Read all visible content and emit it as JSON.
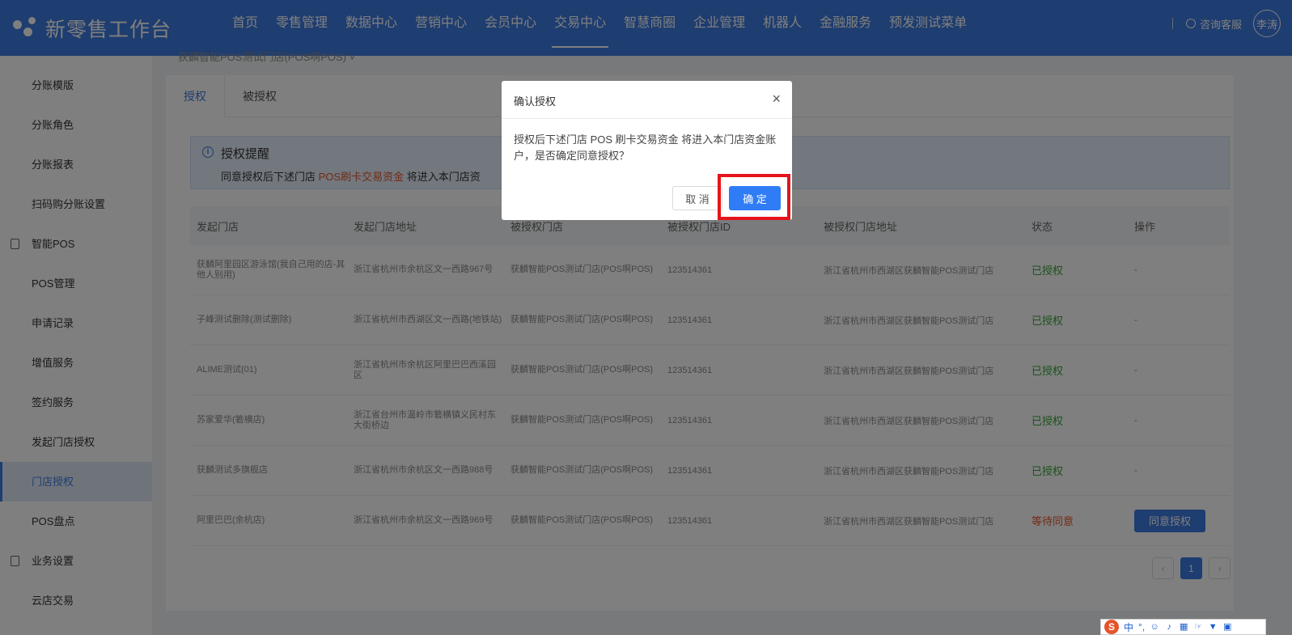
{
  "brand": {
    "title": "新零售工作台"
  },
  "nav": {
    "items": [
      {
        "label": "首页"
      },
      {
        "label": "零售管理"
      },
      {
        "label": "数据中心"
      },
      {
        "label": "营销中心"
      },
      {
        "label": "会员中心"
      },
      {
        "label": "交易中心",
        "active": true
      },
      {
        "label": "智慧商圈"
      },
      {
        "label": "企业管理"
      },
      {
        "label": "机器人"
      },
      {
        "label": "金融服务"
      },
      {
        "label": "预发测试菜单"
      }
    ],
    "consult": "咨询客服",
    "user": "李涛"
  },
  "sidebar": {
    "items": [
      {
        "label": "分账模版"
      },
      {
        "label": "分账角色"
      },
      {
        "label": "分账报表"
      },
      {
        "label": "扫码购分账设置"
      },
      {
        "label": "智能POS",
        "group": true
      },
      {
        "label": "POS管理"
      },
      {
        "label": "申请记录"
      },
      {
        "label": "增值服务"
      },
      {
        "label": "签约服务"
      },
      {
        "label": "发起门店授权"
      },
      {
        "label": "门店授权",
        "active": true
      },
      {
        "label": "POS盘点"
      },
      {
        "label": "业务设置",
        "group": true
      },
      {
        "label": "云店交易"
      }
    ]
  },
  "breadcrumb": "获麟智能POS测试门店(POS啊POS) ˅",
  "tabs": [
    {
      "label": "授权",
      "active": true
    },
    {
      "label": "被授权"
    }
  ],
  "alert": {
    "title": "授权提醒",
    "text_before": "同意授权后下述门店 ",
    "text_highlight": "POS刷卡交易资金",
    "text_after": " 将进入本门店资"
  },
  "table": {
    "headers": [
      "发起门店",
      "发起门店地址",
      "被授权门店",
      "被授权门店ID",
      "被授权门店地址",
      "状态",
      "操作"
    ],
    "rows": [
      {
        "store": "获麟阿里园区游泳馆(我自己用的店-其他人别用)",
        "addr": "浙江省杭州市余杭区文一西路967号",
        "auth_store": "获麟智能POS测试门店(POS啊POS)",
        "id": "123514361",
        "auth_addr": "浙江省杭州市西湖区获麟智能POS测试门店",
        "status": "已授权",
        "op": "-"
      },
      {
        "store": "子峰测试删除(测试删除)",
        "addr": "浙江省杭州市西湖区文一西路(地铁站)",
        "auth_store": "获麟智能POS测试门店(POS啊POS)",
        "id": "123514361",
        "auth_addr": "浙江省杭州市西湖区获麟智能POS测试门店",
        "status": "已授权",
        "op": "-"
      },
      {
        "store": "ALIME测试(01)",
        "addr": "浙江省杭州市余杭区阿里巴巴西溪园区",
        "auth_store": "获麟智能POS测试门店(POS啊POS)",
        "id": "123514361",
        "auth_addr": "浙江省杭州市西湖区获麟智能POS测试门店",
        "status": "已授权",
        "op": "-"
      },
      {
        "store": "苏家爱华(箬横店)",
        "addr": "浙江省台州市温岭市箬横镇义民村东大街桥边",
        "auth_store": "获麟智能POS测试门店(POS啊POS)",
        "id": "123514361",
        "auth_addr": "浙江省杭州市西湖区获麟智能POS测试门店",
        "status": "已授权",
        "op": "-"
      },
      {
        "store": "获麟测试多旗舰店",
        "addr": "浙江省杭州市余杭区文一西路988号",
        "auth_store": "获麟智能POS测试门店(POS啊POS)",
        "id": "123514361",
        "auth_addr": "浙江省杭州市西湖区获麟智能POS测试门店",
        "status": "已授权",
        "op": "-"
      },
      {
        "store": "阿里巴巴(余杭店)",
        "addr": "浙江省杭州市余杭区文一西路969号",
        "auth_store": "获麟智能POS测试门店(POS啊POS)",
        "id": "123514361",
        "auth_addr": "浙江省杭州市西湖区获麟智能POS测试门店",
        "status": "等待同意",
        "op_button": "同意授权"
      }
    ]
  },
  "pagination": {
    "prev": "‹",
    "current": "1",
    "next": "›"
  },
  "modal": {
    "title": "确认授权",
    "close": "×",
    "body": "授权后下述门店 POS 刷卡交易资金 将进入本门店资金账户，是否确定同意授权？",
    "cancel": "取 消",
    "ok": "确 定"
  },
  "ime": {
    "logo": "S",
    "lang": "中",
    "punct": "°,",
    "icons": [
      "emoji-icon",
      "mic-icon",
      "keyboard-icon",
      "hand-icon",
      "shirt-icon",
      "grid-icon"
    ]
  },
  "colors": {
    "primary": "#3d7be0",
    "highlight": "#e6141c",
    "success": "#3aa53a",
    "warning": "#e4542a"
  }
}
